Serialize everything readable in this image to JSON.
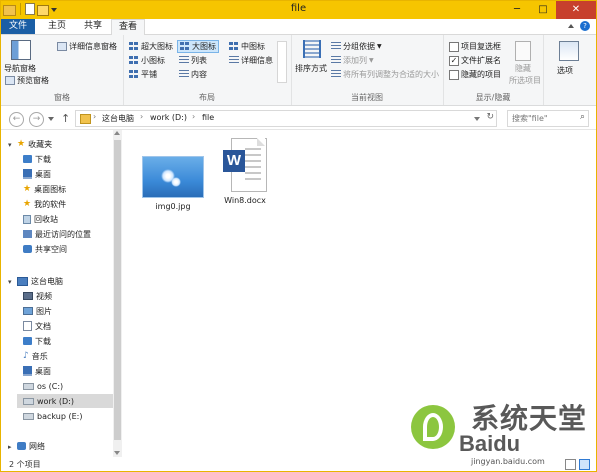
{
  "window": {
    "title": "file",
    "buttons": {
      "minimize": "─",
      "maximize": "□",
      "close": "✕"
    }
  },
  "ribbon_tabs": [
    "文件",
    "主页",
    "共享",
    "查看"
  ],
  "help_icon": "?",
  "ribbon": {
    "panes": {
      "label": "窗格",
      "navigation_pane": "导航窗格",
      "preview_pane": "预览窗格",
      "details_pane": "详细信息窗格"
    },
    "layout": {
      "label": "布局",
      "items": {
        "extra_large": "超大图标",
        "large": "大图标",
        "medium": "中图标",
        "small": "小图标",
        "list": "列表",
        "details": "详细信息",
        "tiles": "平铺",
        "content": "内容"
      }
    },
    "current_view": {
      "label": "当前视图",
      "sort_by": "排序方式",
      "group_by": "分组依据",
      "add_columns": "添加列",
      "size_all_columns": "将所有列调整为合适的大小"
    },
    "show_hide": {
      "label": "显示/隐藏",
      "item_checkboxes": "项目复选框",
      "file_name_extensions": "文件扩展名",
      "hidden_items": "隐藏的项目",
      "hide_selected": "隐藏",
      "selected_items": "所选项目",
      "options": "选项"
    }
  },
  "address": {
    "crumbs": [
      "这台电脑",
      "work (D:)",
      "file"
    ],
    "search_placeholder": "搜索\"file\""
  },
  "nav_pane": {
    "favorites": "收藏夹",
    "favorites_items": [
      "下载",
      "桌面",
      "桌面图标",
      "我的软件",
      "回收站",
      "最近访问的位置",
      "共享空间"
    ],
    "this_pc": "这台电脑",
    "pc_items": [
      "视频",
      "图片",
      "文档",
      "下载",
      "音乐",
      "桌面",
      "os (C:)",
      "work (D:)",
      "backup (E:)"
    ],
    "network": "网络"
  },
  "files": [
    {
      "name": "img0.jpg",
      "type": "image"
    },
    {
      "name": "Win8.docx",
      "type": "word"
    }
  ],
  "status": {
    "item_count": "2 个项目"
  },
  "watermark": {
    "line1": "系统天堂",
    "line2": "Baidu",
    "line3": "jingyan.baidu.com"
  },
  "colors": {
    "title_bar": "#f6c500",
    "file_tab": "#1a5ea5",
    "close_button": "#c7402d",
    "selection": "#cde6fb"
  }
}
